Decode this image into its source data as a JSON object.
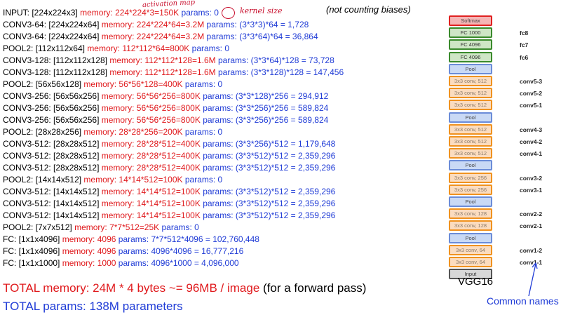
{
  "note": "(not counting biases)",
  "handwritten": {
    "activation": "activation map",
    "kernel": "kernel size"
  },
  "rows": [
    {
      "label": "INPUT: [224x224x3]",
      "mem": "memory: 224*224*3=150K",
      "par": "params: 0"
    },
    {
      "label": "CONV3-64: [224x224x64]",
      "mem": "memory: 224*224*64=3.2M",
      "par": "params: (3*3*3)*64 = 1,728"
    },
    {
      "label": "CONV3-64: [224x224x64]",
      "mem": "memory: 224*224*64=3.2M",
      "par": "params: (3*3*64)*64 = 36,864"
    },
    {
      "label": "POOL2: [112x112x64]",
      "mem": "memory: 112*112*64=800K",
      "par": "params: 0"
    },
    {
      "label": "CONV3-128: [112x112x128]",
      "mem": "memory: 112*112*128=1.6M",
      "par": "params: (3*3*64)*128 = 73,728"
    },
    {
      "label": "CONV3-128: [112x112x128]",
      "mem": "memory: 112*112*128=1.6M",
      "par": "params: (3*3*128)*128 = 147,456"
    },
    {
      "label": "POOL2: [56x56x128]",
      "mem": "memory: 56*56*128=400K",
      "par": "params: 0"
    },
    {
      "label": "CONV3-256: [56x56x256]",
      "mem": "memory: 56*56*256=800K",
      "par": "params: (3*3*128)*256 = 294,912"
    },
    {
      "label": "CONV3-256: [56x56x256]",
      "mem": "memory: 56*56*256=800K",
      "par": "params: (3*3*256)*256 = 589,824"
    },
    {
      "label": "CONV3-256: [56x56x256]",
      "mem": "memory: 56*56*256=800K",
      "par": "params: (3*3*256)*256 = 589,824"
    },
    {
      "label": "POOL2: [28x28x256]",
      "mem": "memory: 28*28*256=200K",
      "par": "params: 0"
    },
    {
      "label": "CONV3-512: [28x28x512]",
      "mem": "memory: 28*28*512=400K",
      "par": "params: (3*3*256)*512 = 1,179,648"
    },
    {
      "label": "CONV3-512: [28x28x512]",
      "mem": "memory: 28*28*512=400K",
      "par": "params: (3*3*512)*512 = 2,359,296"
    },
    {
      "label": "CONV3-512: [28x28x512]",
      "mem": "memory: 28*28*512=400K",
      "par": "params: (3*3*512)*512 = 2,359,296"
    },
    {
      "label": "POOL2: [14x14x512]",
      "mem": "memory: 14*14*512=100K",
      "par": "params: 0"
    },
    {
      "label": "CONV3-512: [14x14x512]",
      "mem": "memory: 14*14*512=100K",
      "par": "params: (3*3*512)*512 = 2,359,296"
    },
    {
      "label": "CONV3-512: [14x14x512]",
      "mem": "memory: 14*14*512=100K",
      "par": "params: (3*3*512)*512 = 2,359,296"
    },
    {
      "label": "CONV3-512: [14x14x512]",
      "mem": "memory: 14*14*512=100K",
      "par": "params: (3*3*512)*512 = 2,359,296"
    },
    {
      "label": "POOL2: [7x7x512]",
      "mem": "memory: 7*7*512=25K",
      "par": "params: 0"
    },
    {
      "label": "FC: [1x1x4096]",
      "mem": "memory: 4096",
      "par": "params: 7*7*512*4096 = 102,760,448"
    },
    {
      "label": "FC: [1x1x4096]",
      "mem": "memory: 4096",
      "par": "params: 4096*4096 = 16,777,216"
    },
    {
      "label": "FC: [1x1x1000]",
      "mem": "memory: 1000",
      "par": "params: 4096*1000 = 4,096,000"
    }
  ],
  "total_memory": "TOTAL memory: 24M * 4 bytes ~= 96MB / image",
  "total_memory_suffix": "(for a forward pass)",
  "total_params": "TOTAL params: 138M parameters",
  "architecture": {
    "title": "VGG16",
    "common_names_label": "Common names",
    "layers": [
      {
        "text": "Softmax",
        "kind": "soft",
        "name": ""
      },
      {
        "text": "FC 1000",
        "kind": "fc",
        "name": "fc8"
      },
      {
        "text": "FC 4096",
        "kind": "fc",
        "name": "fc7"
      },
      {
        "text": "FC 4096",
        "kind": "fc",
        "name": "fc6"
      },
      {
        "text": "Pool",
        "kind": "pool",
        "name": ""
      },
      {
        "text": "3x3 conv, 512",
        "kind": "conv",
        "name": "conv5-3"
      },
      {
        "text": "3x3 conv, 512",
        "kind": "conv",
        "name": "conv5-2"
      },
      {
        "text": "3x3 conv, 512",
        "kind": "conv",
        "name": "conv5-1"
      },
      {
        "text": "Pool",
        "kind": "pool",
        "name": ""
      },
      {
        "text": "3x3 conv, 512",
        "kind": "conv",
        "name": "conv4-3"
      },
      {
        "text": "3x3 conv, 512",
        "kind": "conv",
        "name": "conv4-2"
      },
      {
        "text": "3x3 conv, 512",
        "kind": "conv",
        "name": "conv4-1"
      },
      {
        "text": "Pool",
        "kind": "pool",
        "name": ""
      },
      {
        "text": "3x3 conv, 256",
        "kind": "conv",
        "name": "conv3-2"
      },
      {
        "text": "3x3 conv, 256",
        "kind": "conv",
        "name": "conv3-1"
      },
      {
        "text": "Pool",
        "kind": "pool",
        "name": ""
      },
      {
        "text": "3x3 conv, 128",
        "kind": "conv",
        "name": "conv2-2"
      },
      {
        "text": "3x3 conv, 128",
        "kind": "conv",
        "name": "conv2-1"
      },
      {
        "text": "Pool",
        "kind": "pool",
        "name": ""
      },
      {
        "text": "3x3 conv, 64",
        "kind": "conv",
        "name": "conv1-2"
      },
      {
        "text": "3x3 conv, 64",
        "kind": "conv",
        "name": "conv1-1"
      },
      {
        "text": "Input",
        "kind": "input",
        "name": ""
      }
    ]
  }
}
